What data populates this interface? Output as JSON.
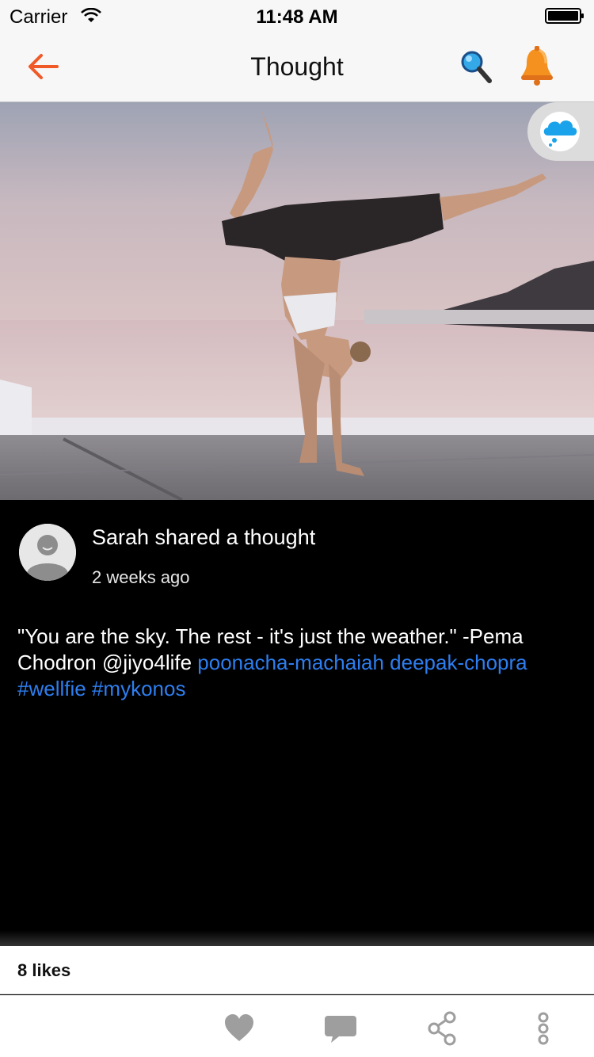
{
  "status_bar": {
    "carrier": "Carrier",
    "time": "11:48 AM",
    "icons": [
      "wifi-icon",
      "battery-icon"
    ]
  },
  "nav": {
    "title": "Thought",
    "back_icon": "back-arrow-icon",
    "search_icon": "search-icon",
    "bell_icon": "bell-icon",
    "accent_color": "#f05a28"
  },
  "photo": {
    "badge_icon": "thought-cloud-icon",
    "badge_color": "#1aa3ea"
  },
  "post": {
    "author_line": "Sarah shared a thought",
    "time_ago": "2 weeks ago",
    "text_plain": "\"You are the sky. The rest - it's just the weather.\" -Pema Chodron @jiyo4life ",
    "links": [
      "poonacha-machaiah",
      "deepak-chopra",
      "#wellfie",
      "#mykonos"
    ],
    "link_color": "#2d7ef0"
  },
  "likes": {
    "count_label": "8 likes"
  },
  "actions": [
    {
      "icon": "heart-icon"
    },
    {
      "icon": "comment-icon"
    },
    {
      "icon": "share-icon"
    },
    {
      "icon": "more-icon"
    }
  ]
}
